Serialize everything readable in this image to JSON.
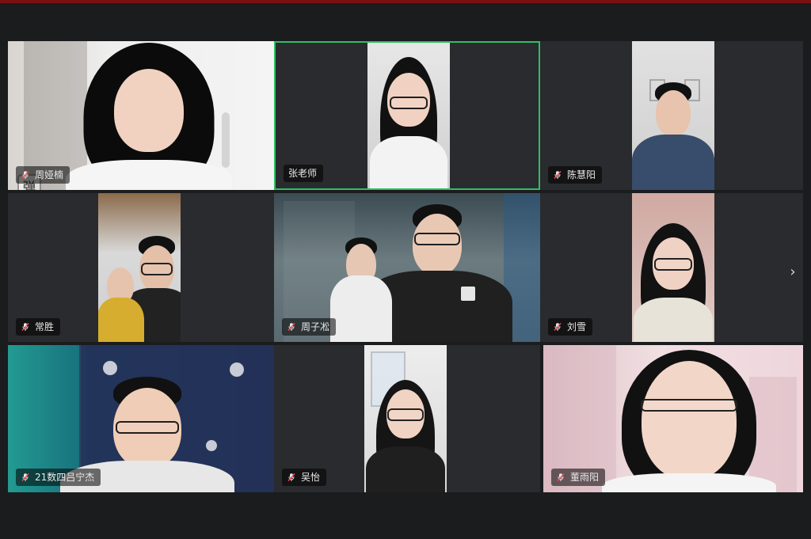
{
  "window": {
    "accent_active": "#2fbf63",
    "background": "#1b1c1e",
    "top_strip": "#7a1010"
  },
  "participants": [
    {
      "id": "p1",
      "name": "周娅楠",
      "muted": true
    },
    {
      "id": "p2",
      "name": "张老师",
      "muted": false,
      "active_speaker": true
    },
    {
      "id": "p3",
      "name": "陈慧阳",
      "muted": true
    },
    {
      "id": "p4",
      "name": "常胜",
      "muted": true
    },
    {
      "id": "p5",
      "name": "周子凇",
      "muted": true
    },
    {
      "id": "p6",
      "name": "刘雪",
      "muted": true
    },
    {
      "id": "p7",
      "name": "21数四吕宁杰",
      "muted": true
    },
    {
      "id": "p8",
      "name": "吴怡",
      "muted": true
    },
    {
      "id": "p9",
      "name": "董雨阳",
      "muted": true
    }
  ],
  "navigation": {
    "next_page_icon": "chevron-right-icon"
  },
  "overlay": {
    "watermark_glyph": "弹"
  }
}
